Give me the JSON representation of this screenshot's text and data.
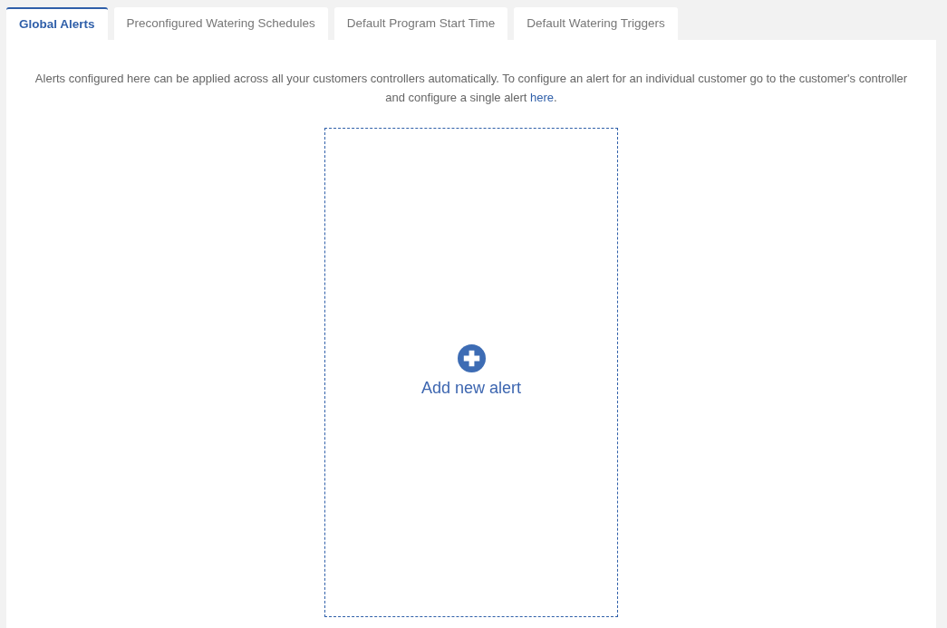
{
  "tabs": [
    {
      "label": "Global Alerts",
      "selected": true
    },
    {
      "label": "Preconfigured Watering Schedules",
      "selected": false
    },
    {
      "label": "Default Program Start Time",
      "selected": false
    },
    {
      "label": "Default Watering Triggers",
      "selected": false
    }
  ],
  "intro": {
    "text": "Alerts configured here can be applied across all your customers controllers automatically. To configure an alert for an individual customer go to the customer's controller and configure a single alert ",
    "link": "here",
    "after": "."
  },
  "add_card": {
    "label": "Add new alert"
  }
}
